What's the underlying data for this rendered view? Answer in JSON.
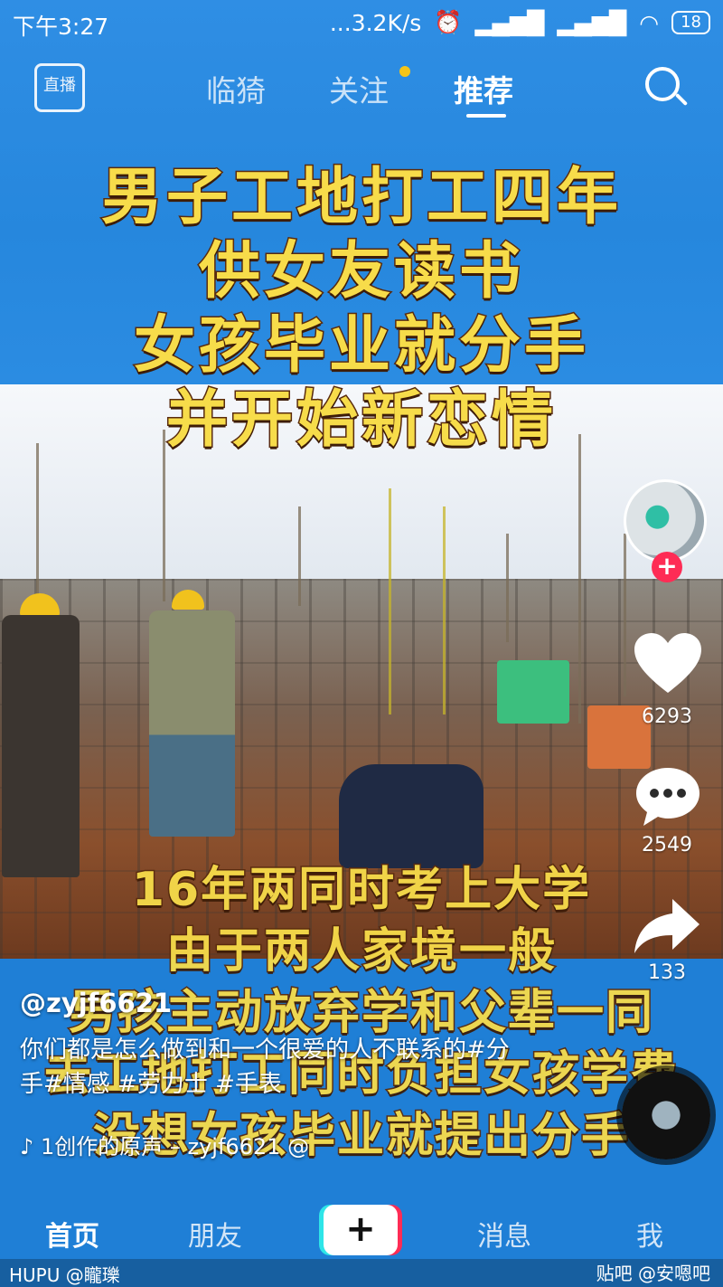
{
  "status_bar": {
    "time": "下午3:27",
    "network_speed": "...3.2K/s",
    "battery": "18"
  },
  "top_nav": {
    "live_label": "直播",
    "tabs": [
      {
        "label": "临猗"
      },
      {
        "label": "关注"
      },
      {
        "label": "推荐"
      }
    ],
    "active_tab": "推荐"
  },
  "video": {
    "caption_top": [
      "男子工地打工四年",
      "供女友读书",
      "女孩毕业就分手",
      "并开始新恋情"
    ],
    "caption_bottom": [
      "16年两同时考上大学",
      "由于两人家境一般",
      "男孩主动放弃学和父辈一同",
      "去工地打工同时负担女孩学费",
      "没想女孩毕业就提出分手"
    ]
  },
  "actions": {
    "likes": "6293",
    "comments": "2549",
    "shares": "133"
  },
  "post": {
    "username": "@zyjf6621",
    "description": "你们都是怎么做到和一个很爱的人不联系的#分手#情感 #劳力士 #手表",
    "music": "1创作的原声 – zyjf6621   @"
  },
  "bottom_nav": {
    "items": [
      "首页",
      "朋友",
      "消息",
      "我"
    ],
    "plus": "+"
  },
  "watermark": {
    "left": "HUPU @矓瓅",
    "right": "贴吧 @安嗯吧"
  },
  "colors": {
    "caption": "#f7dc4a",
    "follow": "#fe2c55",
    "accent_cyan": "#2ee5e8"
  }
}
